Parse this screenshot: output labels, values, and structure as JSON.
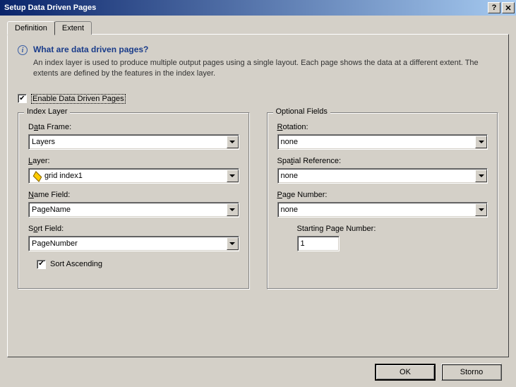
{
  "title": "Setup Data Driven Pages",
  "tabs": {
    "definition": "Definition",
    "extent": "Extent"
  },
  "info": {
    "heading": "What are data driven pages?",
    "body": "An index layer is used to produce multiple output pages using a single layout.   Each page shows the data at a different extent.  The extents are defined by the features in the index layer."
  },
  "enable_label": "Enable Data Driven Pages",
  "enable_checked": true,
  "index_layer": {
    "legend": "Index Layer",
    "data_frame_label_pre": "D",
    "data_frame_label_u": "a",
    "data_frame_label_post": "ta Frame:",
    "data_frame_value": "Layers",
    "layer_label_u": "L",
    "layer_label_post": "ayer:",
    "layer_value": "grid index1",
    "name_field_label_u": "N",
    "name_field_label_post": "ame Field:",
    "name_field_value": "PageName",
    "sort_field_label_pre": "S",
    "sort_field_label_u": "o",
    "sort_field_label_post": "rt Field:",
    "sort_field_value": "PageNumber",
    "sort_asc_label": "Sort Ascending",
    "sort_asc_checked": true
  },
  "optional": {
    "legend": "Optional Fields",
    "rotation_label_u": "R",
    "rotation_label_post": "otation:",
    "rotation_value": "none",
    "srs_label_pre": "Spa",
    "srs_label_u": "t",
    "srs_label_post": "ial Reference:",
    "srs_value": "none",
    "page_num_label_u": "P",
    "page_num_label_post": "age Number:",
    "page_num_value": "none",
    "starting_label": "Starting Page Number:",
    "starting_value": "1"
  },
  "buttons": {
    "ok": "OK",
    "cancel": "Storno"
  }
}
